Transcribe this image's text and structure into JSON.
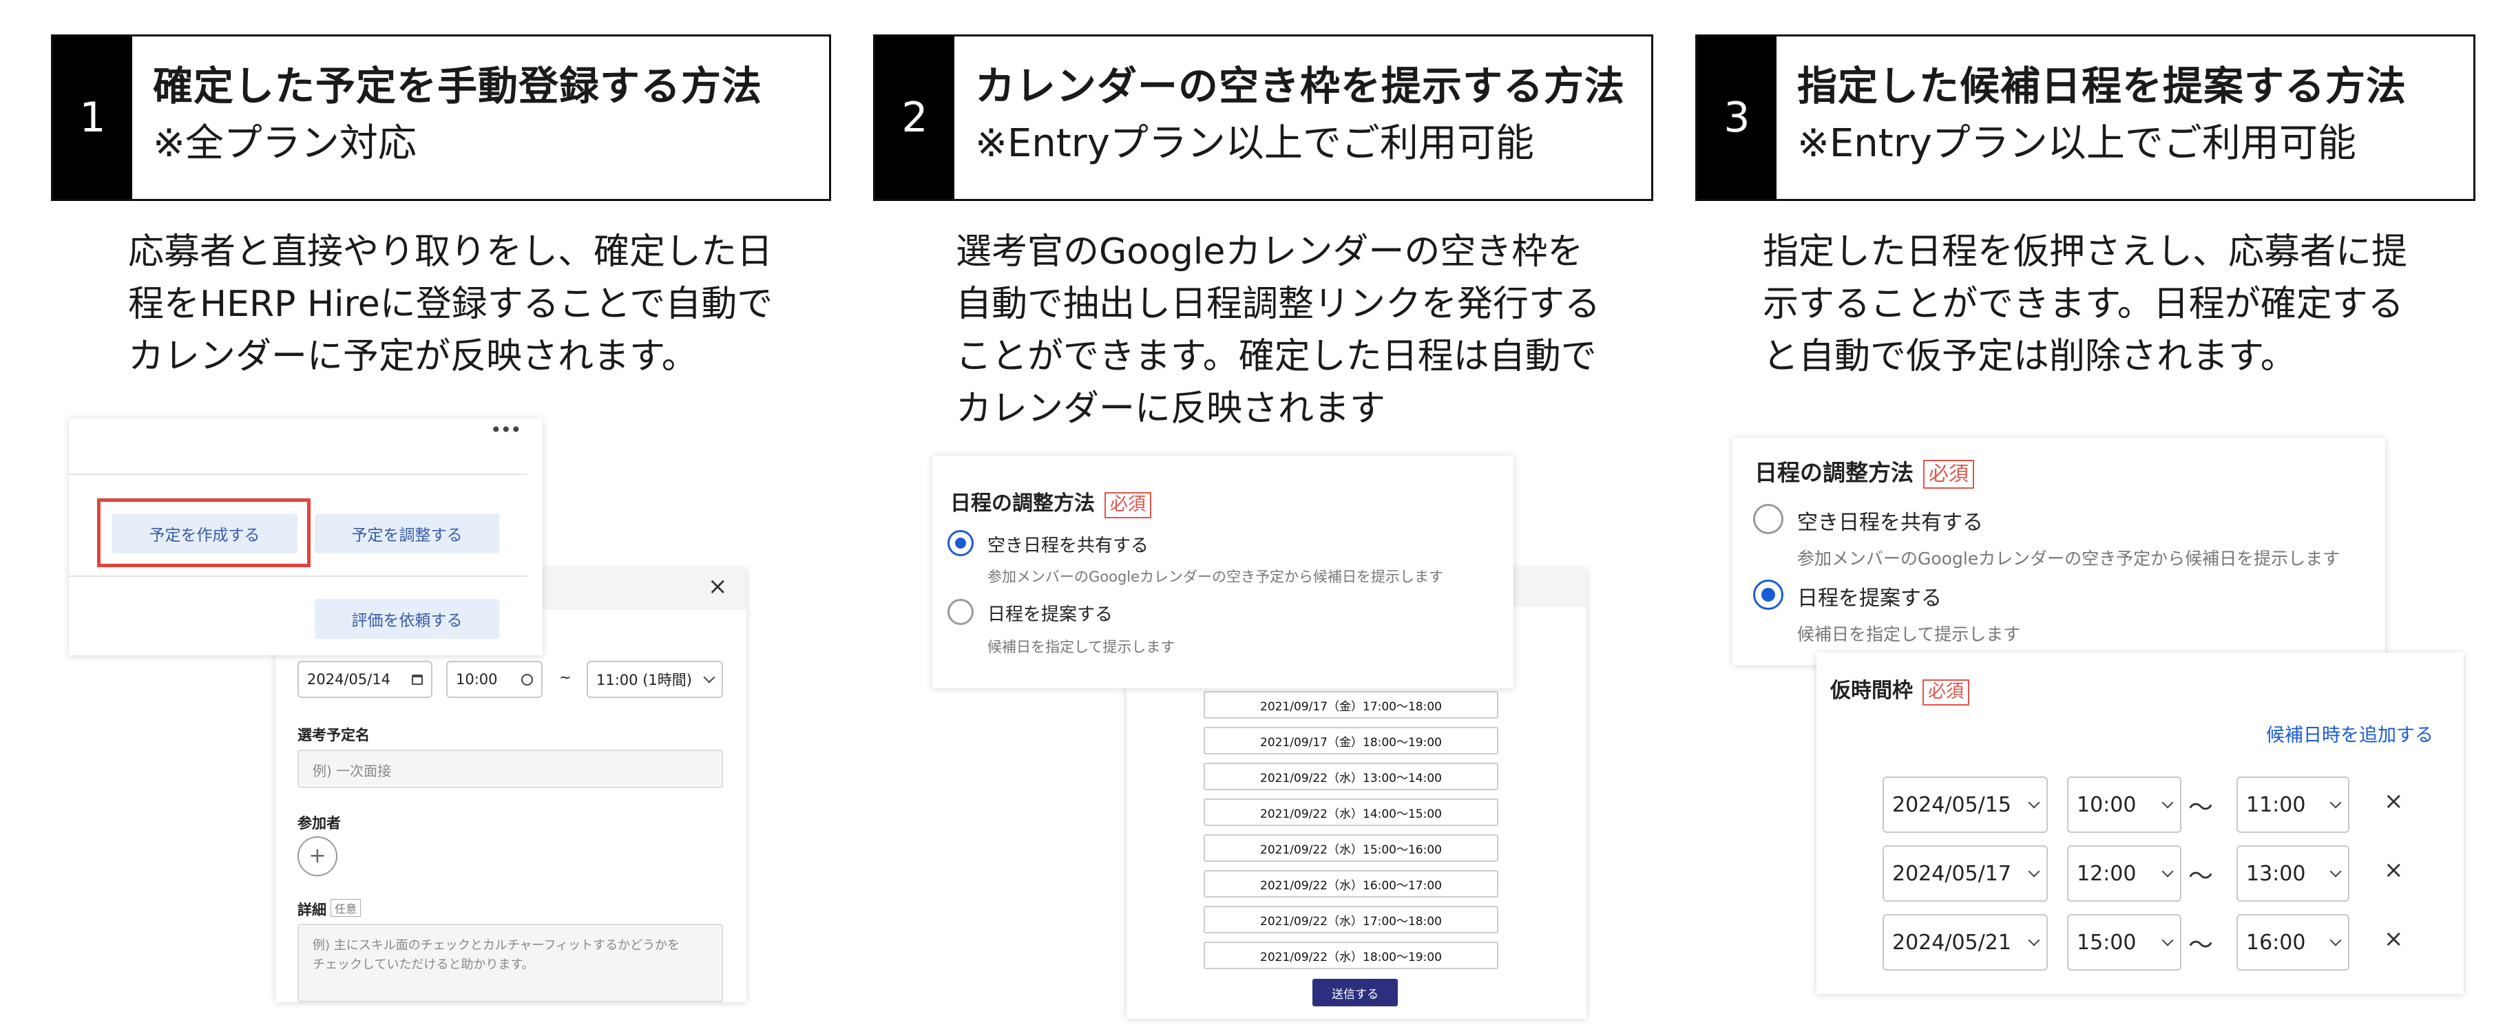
{
  "columns": [
    {
      "number": "1",
      "title": "確定した予定を手動登録する方法",
      "subtitle": "※全プラン対応",
      "description": "応募者と直接やり取りをし、確定した日\n程をHERP Hireに登録することで自動で\nカレンダーに予定が反映されます。"
    },
    {
      "number": "2",
      "title": "カレンダーの空き枠を提示する方法",
      "subtitle": "※Entryプラン以上でご利用可能",
      "description": "選考官のGoogleカレンダーの空き枠を\n自動で抽出し日程調整リンクを発行する\nことができます。確定した日程は自動で\nカレンダーに反映されます"
    },
    {
      "number": "3",
      "title": "指定した候補日程を提案する方法",
      "subtitle": "※Entryプラン以上でご利用可能",
      "description": "指定した日程を仮押さえし、応募者に提\n示することができます。日程が確定する\nと自動で仮予定は削除されます。"
    }
  ],
  "panel1": {
    "menu_icon": "•••",
    "create_button": "予定を作成する",
    "adjust_button": "予定を調整する",
    "evaluate_button": "評価を依頼する",
    "close_icon": "×",
    "date_value": "2024/05/14",
    "time_value": "10:00",
    "tilde": "~",
    "end_time_value": "11:00 (1時間)",
    "event_name_label": "選考予定名",
    "event_name_placeholder": "例) 一次面接",
    "participants_label": "参加者",
    "add_icon": "+",
    "details_label": "詳細",
    "optional_badge": "任意",
    "details_placeholder": "例) 主にスキル面のチェックとカルチャーフィットするかどうかを\nチェックしていただけると助かります。"
  },
  "panel2": {
    "method_label": "日程の調整方法",
    "required_badge": "必須",
    "option1_label": "空き日程を共有する",
    "option1_hint": "参加メンバーのGoogleカレンダーの空き予定から候補日を提示します",
    "option2_label": "日程を提案する",
    "option2_hint": "候補日を指定して提示します",
    "slots": [
      "2021/09/17（金）17:00〜18:00",
      "2021/09/17（金）18:00〜19:00",
      "2021/09/22（水）13:00〜14:00",
      "2021/09/22（水）14:00〜15:00",
      "2021/09/22（水）15:00〜16:00",
      "2021/09/22（水）16:00〜17:00",
      "2021/09/22（水）17:00〜18:00",
      "2021/09/22（水）18:00〜19:00"
    ],
    "submit_button": "送信する"
  },
  "panel3": {
    "method_label": "日程の調整方法",
    "required_badge": "必須",
    "option1_label": "空き日程を共有する",
    "option1_hint": "参加メンバーのGoogleカレンダーの空き予定から候補日を提示します",
    "option2_label": "日程を提案する",
    "option2_hint": "候補日を指定して提示します",
    "tentative_label": "仮時間枠",
    "add_candidate_link": "候補日時を追加する",
    "rows": [
      {
        "date": "2024/05/15",
        "start": "10:00",
        "end": "11:00"
      },
      {
        "date": "2024/05/17",
        "start": "12:00",
        "end": "13:00"
      },
      {
        "date": "2024/05/21",
        "start": "15:00",
        "end": "16:00"
      }
    ],
    "range_sep": "〜",
    "remove_icon": "×"
  },
  "colors": {
    "highlight_red": "#e0443a",
    "link_blue": "#1a5bd6",
    "submit_navy": "#2c2f7e",
    "soft_button_bg": "#e6eefa"
  }
}
